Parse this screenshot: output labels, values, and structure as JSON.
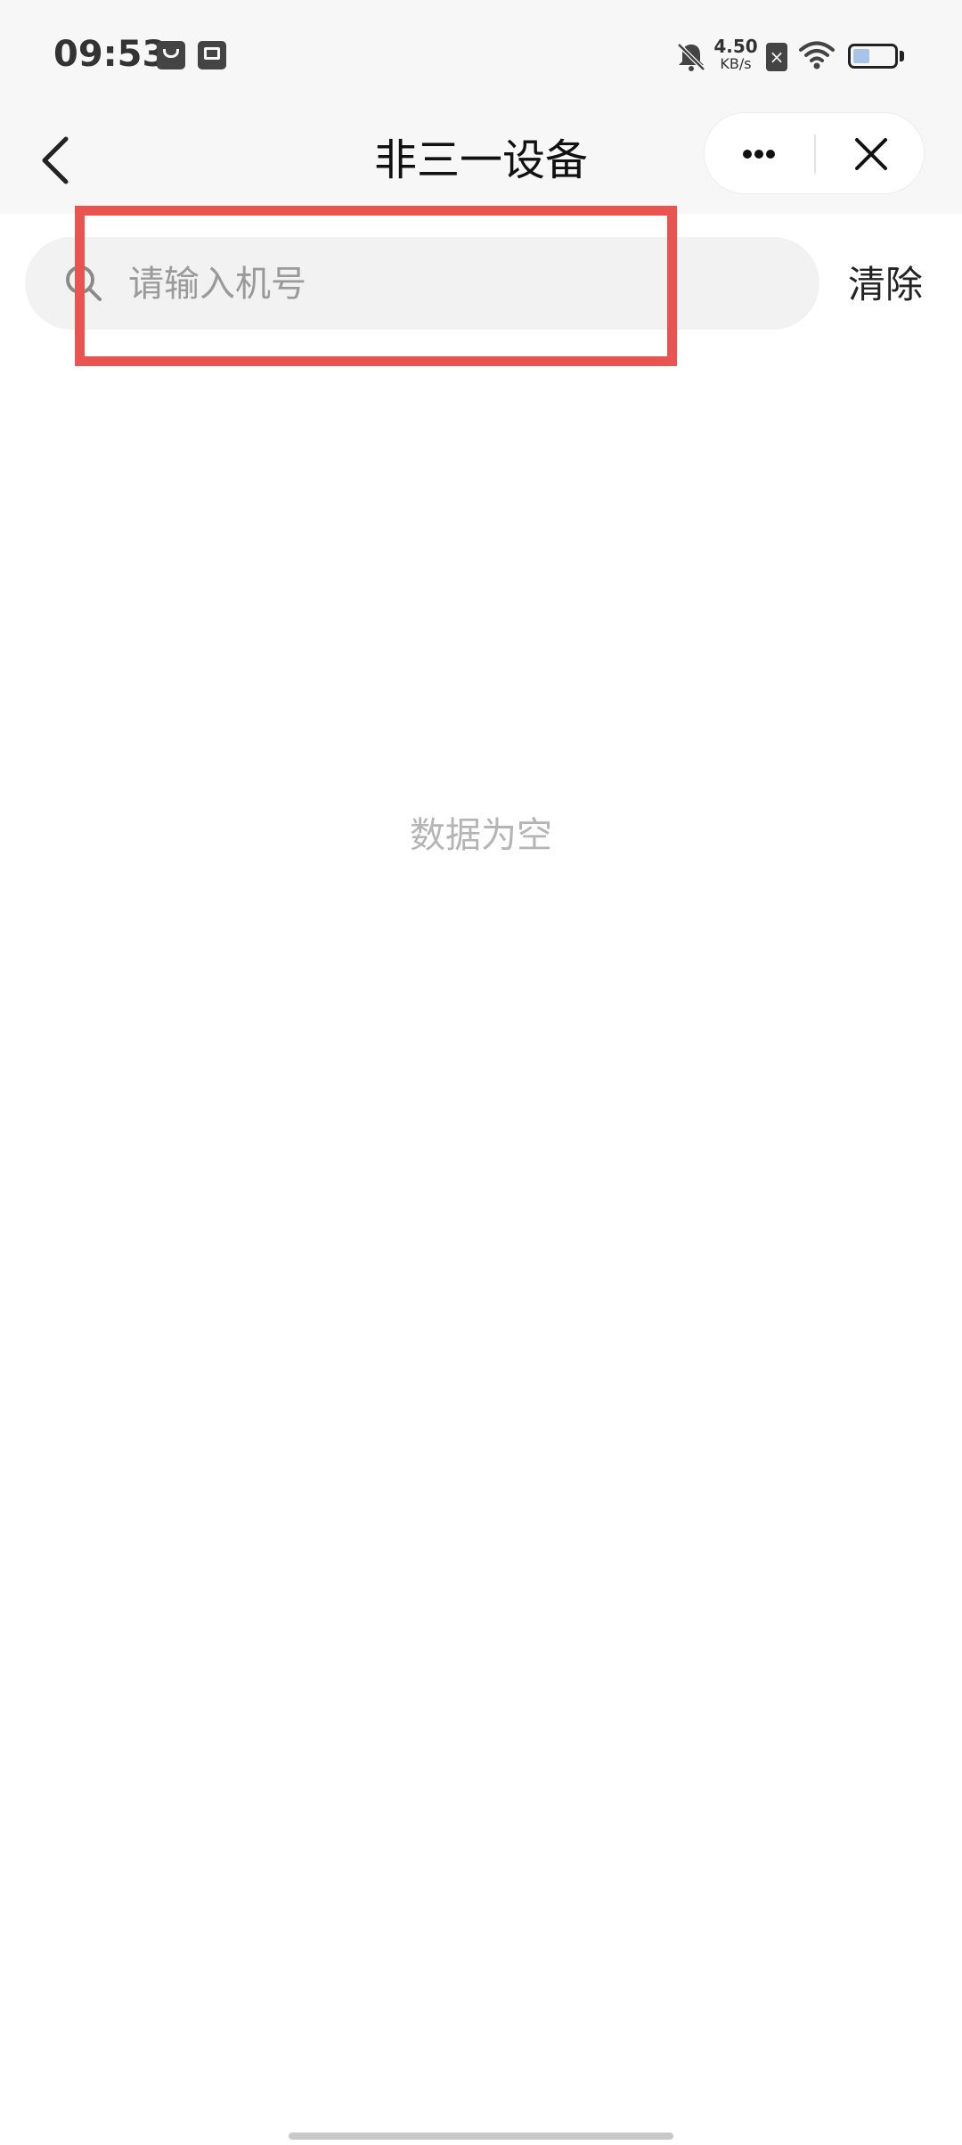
{
  "status_bar": {
    "time": "09:53",
    "net_speed_value": "4.50",
    "net_speed_unit": "KB/s",
    "icons": [
      "mall-bag-icon",
      "inbox-check-icon",
      "muted-bell-icon",
      "no-sim-icon",
      "wifi-icon",
      "battery-icon"
    ],
    "battery_level": 0.4
  },
  "nav": {
    "title": "非三一设备",
    "back_icon": "chevron-left-icon",
    "more_icon": "more-dots-icon",
    "close_icon": "close-icon"
  },
  "search": {
    "placeholder": "请输入机号",
    "value": "",
    "clear_label": "清除",
    "icon": "search-icon"
  },
  "content": {
    "empty_text": "数据为空"
  },
  "colors": {
    "highlight": "#ea5450",
    "header_bg": "#f7f7f7",
    "search_bg": "#f2f2f2",
    "empty_text": "#b5b5b5"
  }
}
